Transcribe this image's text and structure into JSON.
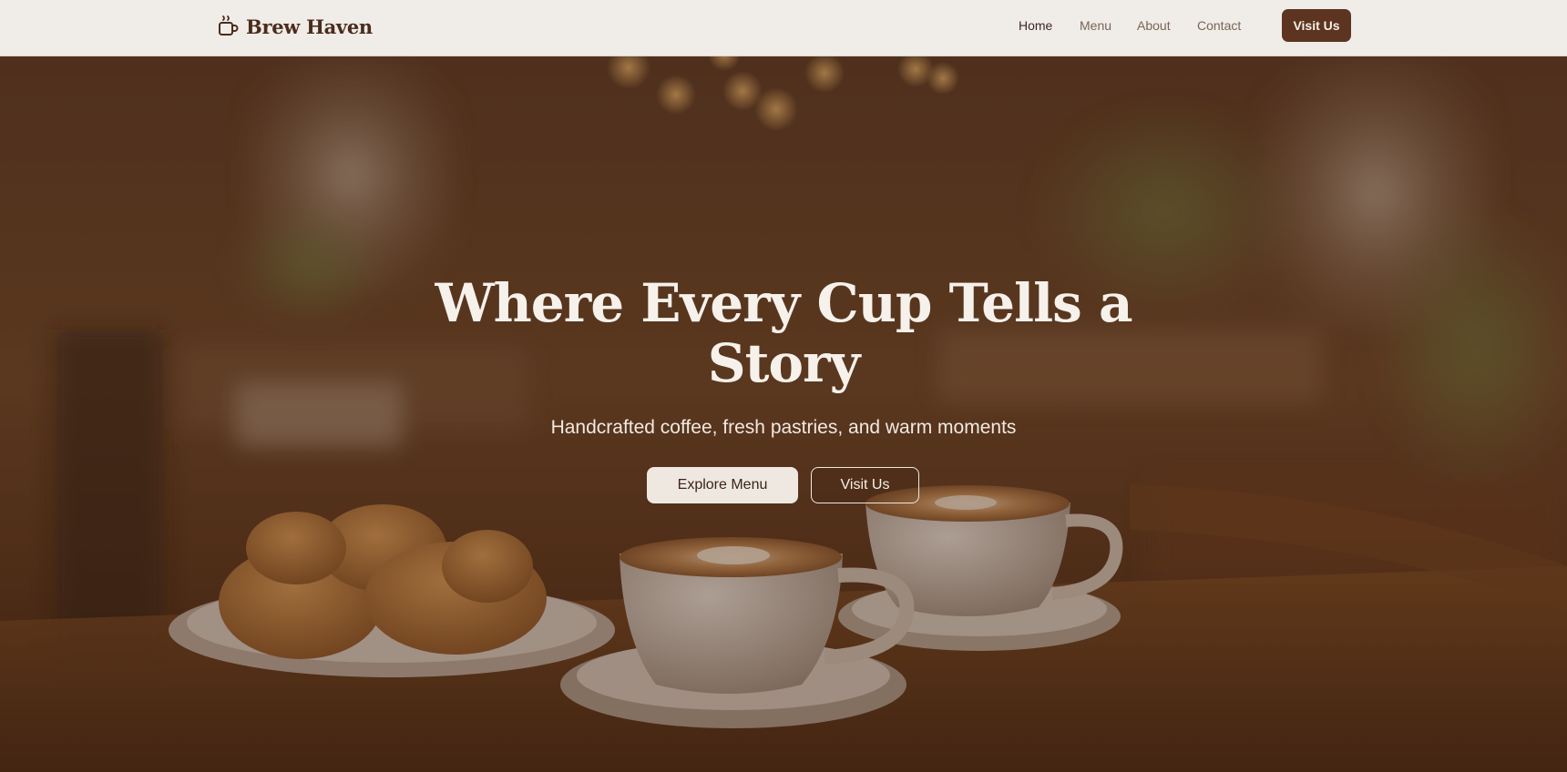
{
  "brand": {
    "name": "Brew Haven",
    "icon": "coffee-cup-icon"
  },
  "nav": {
    "items": [
      {
        "label": "Home",
        "active": true
      },
      {
        "label": "Menu",
        "active": false
      },
      {
        "label": "About",
        "active": false
      },
      {
        "label": "Contact",
        "active": false
      }
    ],
    "cta_label": "Visit Us"
  },
  "hero": {
    "title": "Where Every Cup Tells a Story",
    "subtitle": "Handcrafted coffee, fresh pastries, and warm moments",
    "primary_button": "Explore Menu",
    "secondary_button": "Visit Us"
  },
  "colors": {
    "header_bg": "#f0ece8",
    "brand_text": "#4a2c1d",
    "cta_bg": "#5c3420",
    "hero_overlay": "#3c2010",
    "light_button_bg": "#efe8e1"
  }
}
